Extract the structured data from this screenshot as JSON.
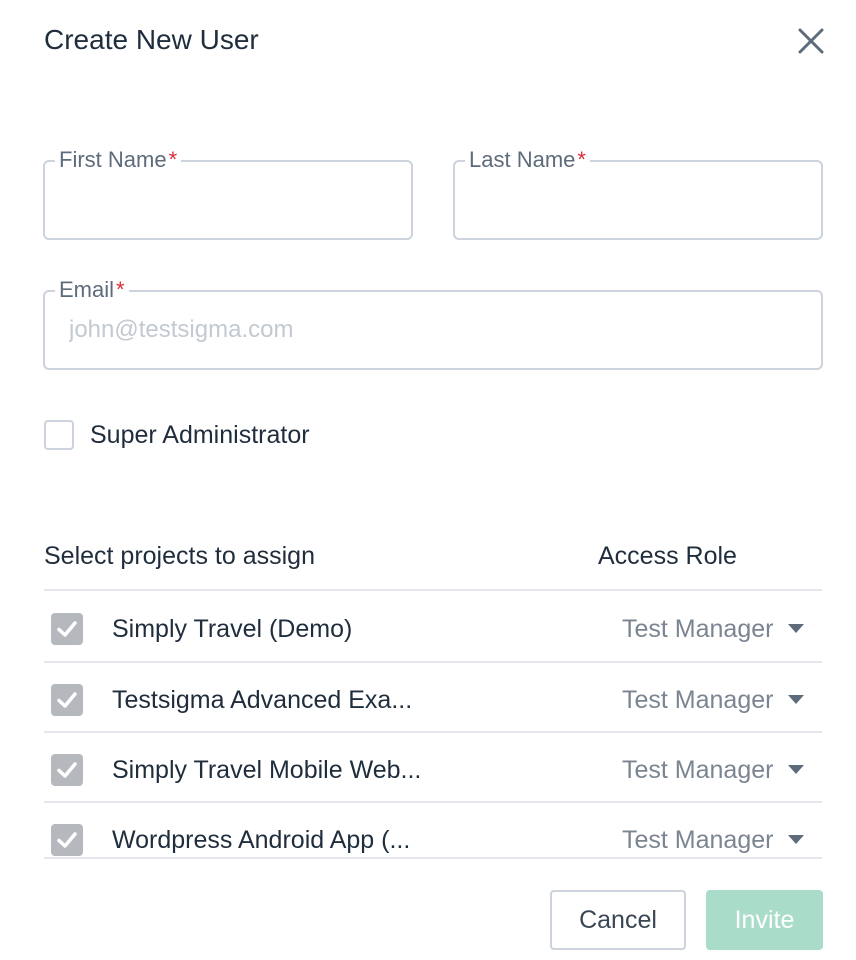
{
  "dialog": {
    "title": "Create New User"
  },
  "form": {
    "first_name": {
      "label": "First Name",
      "required_mark": "*",
      "value": "",
      "placeholder": ""
    },
    "last_name": {
      "label": "Last Name",
      "required_mark": "*",
      "value": "",
      "placeholder": ""
    },
    "email": {
      "label": "Email",
      "required_mark": "*",
      "value": "",
      "placeholder": "john@testsigma.com"
    },
    "super_admin": {
      "label": "Super Administrator",
      "checked": false
    }
  },
  "projects": {
    "header_left": "Select projects to assign",
    "header_right": "Access Role",
    "rows": [
      {
        "name": "Simply Travel (Demo)",
        "role": "Test Manager",
        "checked": true
      },
      {
        "name": "Testsigma Advanced Exa...",
        "role": "Test Manager",
        "checked": true
      },
      {
        "name": "Simply Travel Mobile Web...",
        "role": "Test Manager",
        "checked": true
      },
      {
        "name": "Wordpress Android App (...",
        "role": "Test Manager",
        "checked": true
      }
    ]
  },
  "actions": {
    "cancel": "Cancel",
    "invite": "Invite"
  },
  "colors": {
    "primary_disabled": "#a9dcc9",
    "required": "#d92d3c",
    "text": "#1f2d3d",
    "border": "#ccd3dc"
  },
  "icons": {
    "close": "close-icon",
    "check": "check-icon",
    "dropdown": "chevron-down-icon"
  }
}
